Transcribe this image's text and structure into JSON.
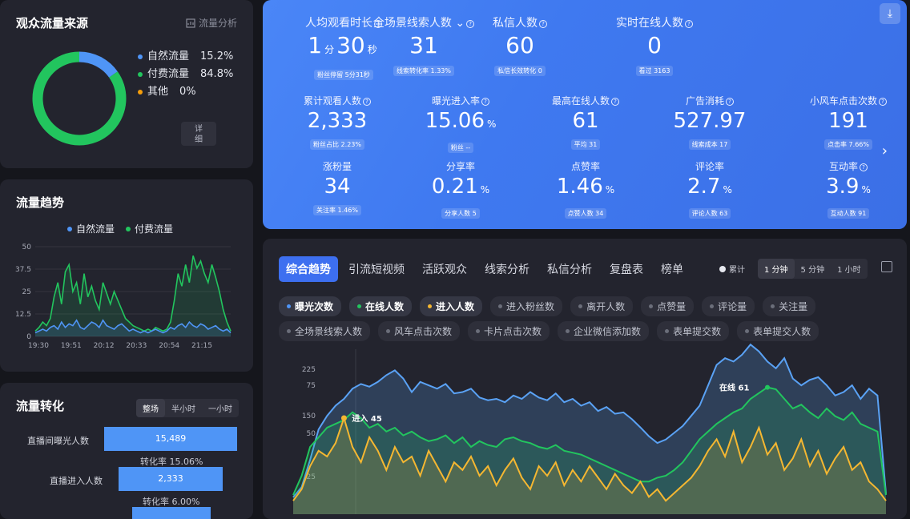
{
  "traffic_source": {
    "title": "观众流量来源",
    "analysis_link": "流量分析",
    "legend": [
      {
        "name": "自然流量",
        "value": "15.2%",
        "pct": 15.2,
        "color": "#4f95f6"
      },
      {
        "name": "付费流量",
        "value": "84.8%",
        "pct": 84.8,
        "color": "#22c55e"
      },
      {
        "name": "其他",
        "value": "0%",
        "pct": 0,
        "color": "#f59e0b"
      }
    ],
    "detail_button": "详\n细"
  },
  "traffic_trend": {
    "title": "流量趋势",
    "legend": [
      {
        "name": "自然流量",
        "color": "#4f95f6"
      },
      {
        "name": "付费流量",
        "color": "#22c55e"
      }
    ],
    "chart_data": {
      "type": "line",
      "x_ticks": [
        "19:30",
        "19:51",
        "20:12",
        "20:33",
        "20:54",
        "21:15"
      ],
      "y_ticks": [
        "0",
        "12.5",
        "25",
        "37.5",
        "50"
      ],
      "ylim": [
        0,
        50
      ],
      "series": [
        {
          "name": "自然流量",
          "color": "#4f95f6",
          "values": [
            2,
            3,
            4,
            3,
            5,
            6,
            4,
            8,
            5,
            7,
            6,
            9,
            5,
            4,
            6,
            8,
            7,
            5,
            9,
            6,
            5,
            4,
            6,
            7,
            5,
            3,
            4,
            3,
            2,
            3,
            2,
            3,
            4,
            3,
            2,
            3,
            5,
            4,
            6,
            7,
            5,
            8,
            6,
            5,
            7,
            6,
            4,
            5,
            6,
            4,
            3,
            4,
            2
          ]
        },
        {
          "name": "付费流量",
          "color": "#22c55e",
          "values": [
            3,
            5,
            8,
            6,
            10,
            22,
            30,
            18,
            36,
            40,
            25,
            30,
            18,
            35,
            22,
            28,
            20,
            15,
            30,
            24,
            18,
            25,
            20,
            15,
            10,
            8,
            6,
            5,
            4,
            3,
            4,
            3,
            5,
            4,
            3,
            4,
            8,
            20,
            35,
            28,
            40,
            30,
            45,
            38,
            42,
            35,
            30,
            40,
            33,
            25,
            15,
            8,
            3
          ]
        }
      ]
    }
  },
  "conversion": {
    "title": "流量转化",
    "segments": [
      "整场",
      "半小时",
      "一小时"
    ],
    "rows": [
      {
        "label": "直播间曝光人数",
        "value": "15,489"
      },
      {
        "label": "直播进入人数",
        "value": "2,333"
      }
    ],
    "rate_prefix": "转化率",
    "rates": [
      "15.06%",
      "6.00%"
    ]
  },
  "hero": {
    "download_icon": "download-icon",
    "row1": [
      {
        "label": "人均观看时长",
        "parts": [
          "1",
          "分",
          "30",
          "秒"
        ],
        "sub": "粉丝停留 5分31秒",
        "chevron": false
      },
      {
        "label": "全场景线索人数",
        "parts": [
          "31"
        ],
        "sub": "线索转化率 1.33%",
        "chevron": true
      },
      {
        "label": "私信人数",
        "parts": [
          "60"
        ],
        "sub": "私信长效转化 0",
        "chevron": false
      },
      {
        "label": "实时在线人数",
        "parts": [
          "0"
        ],
        "sub": "看过 3163",
        "chevron": false
      }
    ],
    "row2": [
      {
        "label": "累计观看人数",
        "value": "2,333",
        "unit": "",
        "sub": "粉丝占比 2.23%"
      },
      {
        "label": "曝光进入率",
        "value": "15.06",
        "unit": "%",
        "sub": "粉丝 --"
      },
      {
        "label": "最高在线人数",
        "value": "61",
        "unit": "",
        "sub": "平均 31"
      },
      {
        "label": "广告消耗",
        "value": "527.97",
        "unit": "",
        "sub": "线索成本 17"
      },
      {
        "label": "小风车点击次数",
        "value": "191",
        "unit": "",
        "sub": "点击率 7.66%"
      }
    ],
    "row3": [
      {
        "label": "涨粉量",
        "value": "34",
        "unit": "",
        "sub": "关注率 1.46%",
        "q": false
      },
      {
        "label": "分享率",
        "value": "0.21",
        "unit": "%",
        "sub": "分享人数 5",
        "q": false
      },
      {
        "label": "点赞率",
        "value": "1.46",
        "unit": "%",
        "sub": "点赞人数 34",
        "q": false
      },
      {
        "label": "评论率",
        "value": "2.7",
        "unit": "%",
        "sub": "评论人数 63",
        "q": false
      },
      {
        "label": "互动率",
        "value": "3.9",
        "unit": "%",
        "sub": "互动人数 91",
        "q": true
      }
    ]
  },
  "main": {
    "tabs": [
      "综合趋势",
      "引流短视频",
      "活跃观众",
      "线索分析",
      "私信分析",
      "复盘表",
      "榜单"
    ],
    "toggle_label": "累计",
    "intervals": [
      "1 分钟",
      "5 分钟",
      "1 小时"
    ],
    "chips_row1": [
      {
        "label": "曝光次数",
        "color": "#4f95f6",
        "on": true
      },
      {
        "label": "在线人数",
        "color": "#22c55e",
        "on": true
      },
      {
        "label": "进入人数",
        "color": "#f5b731",
        "on": true
      },
      {
        "label": "进入粉丝数",
        "color": "#6b6e7a",
        "on": false
      },
      {
        "label": "离开人数",
        "color": "#6b6e7a",
        "on": false
      },
      {
        "label": "点赞量",
        "color": "#6b6e7a",
        "on": false
      },
      {
        "label": "评论量",
        "color": "#6b6e7a",
        "on": false
      },
      {
        "label": "关注量",
        "color": "#6b6e7a",
        "on": false
      }
    ],
    "chips_row2": [
      {
        "label": "全场景线索人数"
      },
      {
        "label": "风车点击次数"
      },
      {
        "label": "卡片点击次数"
      },
      {
        "label": "企业微信添加数"
      },
      {
        "label": "表单提交数"
      },
      {
        "label": "表单提交人数"
      }
    ],
    "chart_data": {
      "type": "area",
      "y_ticks_left": [
        "25",
        "50",
        "75"
      ],
      "y_ticks_right": [
        "150",
        "225"
      ],
      "annotations": [
        "在线 61",
        "进入 45"
      ],
      "series": [
        {
          "name": "曝光次数",
          "color": "#5aa2f5",
          "values": [
            5,
            20,
            60,
            105,
            125,
            140,
            150,
            165,
            172,
            168,
            175,
            185,
            192,
            180,
            160,
            175,
            170,
            165,
            172,
            158,
            160,
            165,
            152,
            148,
            150,
            145,
            155,
            150,
            160,
            152,
            148,
            158,
            145,
            150,
            140,
            145,
            132,
            138,
            128,
            130,
            120,
            108,
            95,
            85,
            90,
            100,
            110,
            125,
            140,
            170,
            200,
            210,
            205,
            215,
            230,
            220,
            205,
            195,
            210,
            180,
            170,
            178,
            182,
            170,
            155,
            160,
            170,
            150,
            165,
            155,
            10
          ]
        },
        {
          "name": "在线人数",
          "color": "#22c55e",
          "values": [
            5,
            15,
            30,
            35,
            40,
            42,
            44,
            48,
            45,
            40,
            42,
            38,
            40,
            36,
            38,
            35,
            33,
            34,
            36,
            32,
            35,
            30,
            33,
            31,
            30,
            34,
            35,
            33,
            32,
            30,
            29,
            31,
            28,
            27,
            26,
            24,
            22,
            20,
            18,
            16,
            14,
            12,
            12,
            14,
            15,
            18,
            22,
            28,
            34,
            38,
            42,
            45,
            48,
            50,
            55,
            58,
            61,
            60,
            55,
            50,
            52,
            48,
            45,
            50,
            46,
            44,
            48,
            42,
            40,
            38,
            5
          ]
        },
        {
          "name": "进入人数",
          "color": "#f5b731",
          "values": [
            2,
            8,
            20,
            28,
            25,
            32,
            45,
            30,
            22,
            35,
            28,
            18,
            30,
            22,
            25,
            15,
            28,
            20,
            12,
            22,
            18,
            25,
            15,
            20,
            10,
            18,
            24,
            14,
            8,
            20,
            15,
            22,
            10,
            18,
            12,
            20,
            14,
            8,
            16,
            10,
            6,
            12,
            4,
            8,
            2,
            6,
            10,
            14,
            20,
            28,
            34,
            25,
            38,
            22,
            30,
            40,
            26,
            32,
            18,
            24,
            34,
            20,
            28,
            16,
            24,
            30,
            18,
            22,
            12,
            8,
            2
          ]
        }
      ]
    }
  }
}
